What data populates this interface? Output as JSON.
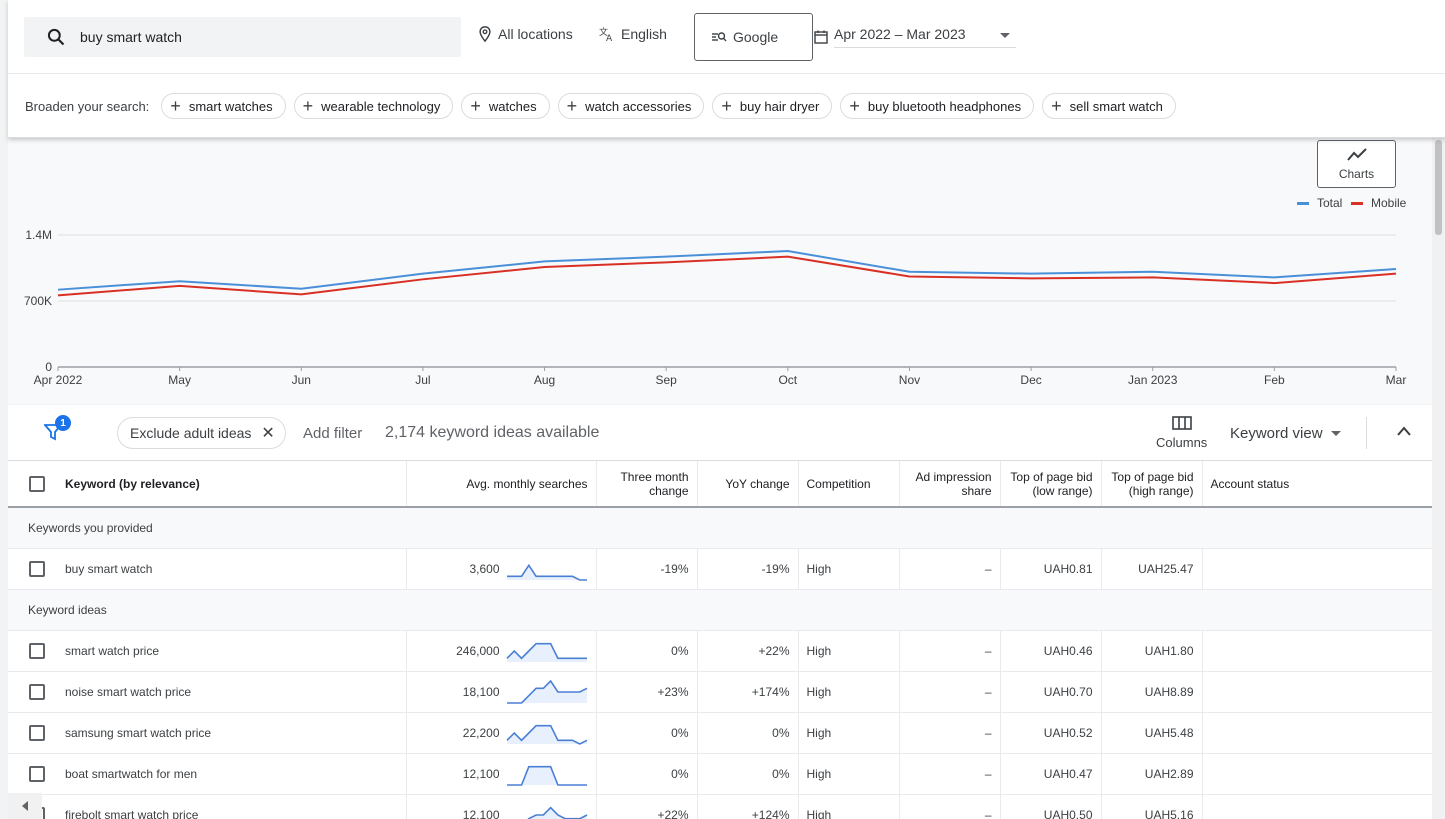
{
  "search": {
    "query": "buy smart watch"
  },
  "filters": {
    "location": "All locations",
    "language": "English",
    "network": "Google",
    "date_range": "Apr 2022 – Mar 2023"
  },
  "broaden": {
    "label": "Broaden your search:",
    "chips": [
      "smart watches",
      "wearable technology",
      "watches",
      "watch accessories",
      "buy hair dryer",
      "buy bluetooth headphones",
      "sell smart watch"
    ]
  },
  "chart_controls": {
    "charts_label": "Charts"
  },
  "chart_data": {
    "type": "line",
    "categories": [
      "Apr 2022",
      "May",
      "Jun",
      "Jul",
      "Aug",
      "Sep",
      "Oct",
      "Nov",
      "Dec",
      "Jan 2023",
      "Feb",
      "Mar"
    ],
    "series": [
      {
        "name": "Total",
        "color": "#4a90d9",
        "values": [
          820000,
          910000,
          830000,
          990000,
          1120000,
          1170000,
          1230000,
          1010000,
          990000,
          1010000,
          950000,
          1040000
        ]
      },
      {
        "name": "Mobile",
        "color": "#d93025",
        "values": [
          760000,
          860000,
          770000,
          930000,
          1060000,
          1110000,
          1170000,
          960000,
          940000,
          950000,
          890000,
          990000
        ]
      }
    ],
    "yticks": [
      "0",
      "700K",
      "1.4M"
    ],
    "ylim": [
      0,
      1400000
    ],
    "grid": true,
    "legend": "top-right"
  },
  "toolbar": {
    "filter_count": "1",
    "exclude_chip": "Exclude adult ideas",
    "add_filter": "Add filter",
    "ideas_count": "2,174 keyword ideas available",
    "columns": "Columns",
    "keyword_view": "Keyword view"
  },
  "table": {
    "headers": {
      "keyword": "Keyword (by relevance)",
      "avg": "Avg. monthly searches",
      "three_month_1": "Three month",
      "three_month_2": "change",
      "yoy": "YoY change",
      "competition": "Competition",
      "ad_imp_1": "Ad impression",
      "ad_imp_2": "share",
      "low_1": "Top of page bid",
      "low_2": "(low range)",
      "high_1": "Top of page bid",
      "high_2": "(high range)",
      "status": "Account status"
    },
    "group1": "Keywords you provided",
    "provided": [
      {
        "keyword": "buy smart watch",
        "avg": "3,600",
        "three": "-19%",
        "yoy": "-19%",
        "comp": "High",
        "imp": "–",
        "low": "UAH0.81",
        "high": "UAH25.47",
        "spark": [
          2,
          2,
          2,
          8,
          2,
          2,
          2,
          2,
          2,
          2,
          0,
          0
        ]
      }
    ],
    "group2": "Keyword ideas",
    "ideas": [
      {
        "keyword": "smart watch price",
        "avg": "246,000",
        "three": "0%",
        "yoy": "+22%",
        "comp": "High",
        "imp": "–",
        "low": "UAH0.46",
        "high": "UAH1.80",
        "spark": [
          2,
          6,
          2,
          6,
          10,
          10,
          10,
          2,
          2,
          2,
          2,
          2
        ]
      },
      {
        "keyword": "noise smart watch price",
        "avg": "18,100",
        "three": "+23%",
        "yoy": "+174%",
        "comp": "High",
        "imp": "–",
        "low": "UAH0.70",
        "high": "UAH8.89",
        "spark": [
          0,
          0,
          0,
          4,
          8,
          8,
          12,
          6,
          6,
          6,
          6,
          8
        ]
      },
      {
        "keyword": "samsung smart watch price",
        "avg": "22,200",
        "three": "0%",
        "yoy": "0%",
        "comp": "High",
        "imp": "–",
        "low": "UAH0.52",
        "high": "UAH5.48",
        "spark": [
          2,
          6,
          2,
          6,
          10,
          10,
          10,
          2,
          2,
          2,
          0,
          2
        ]
      },
      {
        "keyword": "boat smartwatch for men",
        "avg": "12,100",
        "three": "0%",
        "yoy": "0%",
        "comp": "High",
        "imp": "–",
        "low": "UAH0.47",
        "high": "UAH2.89",
        "spark": [
          0,
          0,
          0,
          10,
          10,
          10,
          10,
          0,
          0,
          0,
          0,
          0
        ]
      },
      {
        "keyword": "firebolt smart watch price",
        "avg": "12,100",
        "three": "+22%",
        "yoy": "+124%",
        "comp": "High",
        "imp": "–",
        "low": "UAH0.50",
        "high": "UAH5.16",
        "spark": [
          0,
          0,
          0,
          4,
          6,
          6,
          10,
          6,
          4,
          4,
          4,
          6
        ]
      }
    ]
  }
}
